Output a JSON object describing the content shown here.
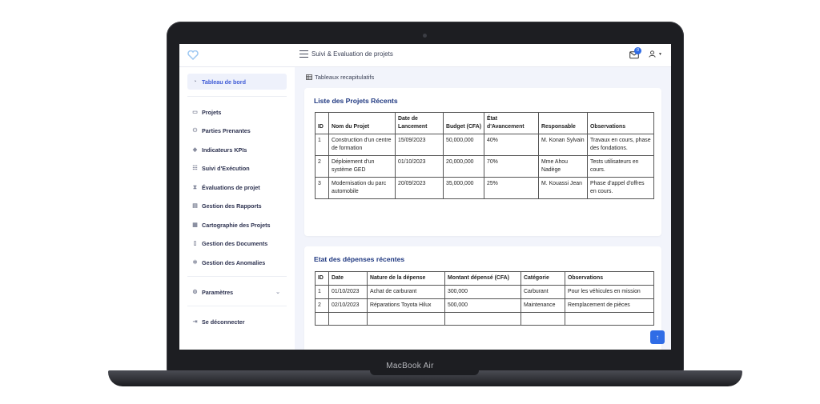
{
  "device": {
    "label": "MacBook Air"
  },
  "topbar": {
    "title": "Suivi & Evaluation de projets",
    "mail_badge": "0"
  },
  "sidebar": {
    "items": [
      {
        "label": "Tableau de bord",
        "icon": "dashboard-icon"
      },
      {
        "label": "Projets",
        "icon": "folder-icon"
      },
      {
        "label": "Parties Prenantes",
        "icon": "users-icon"
      },
      {
        "label": "Indicateurs KPIs",
        "icon": "tag-icon"
      },
      {
        "label": "Suivi d'Exécution",
        "icon": "tasks-icon"
      },
      {
        "label": "Évaluations de projet",
        "icon": "hourglass-icon"
      },
      {
        "label": "Gestion des Rapports",
        "icon": "report-icon"
      },
      {
        "label": "Cartographie des Projets",
        "icon": "map-icon"
      },
      {
        "label": "Gestion des Documents",
        "icon": "document-icon"
      },
      {
        "label": "Gestion des Anomalies",
        "icon": "bug-icon"
      },
      {
        "label": "Paramètres",
        "icon": "settings-icon"
      },
      {
        "label": "Se déconnecter",
        "icon": "logout-icon"
      }
    ]
  },
  "breadcrumb": {
    "label": "Tableaux recapitulatifs"
  },
  "projects": {
    "title": "Liste des Projets Récents",
    "headers": [
      "ID",
      "Nom du Projet",
      "Date de Lancement",
      "Budget (CFA)",
      "État d'Avancement",
      "Responsable",
      "Observations"
    ],
    "rows": [
      [
        "1",
        "Construction d'un centre de formation",
        "15/09/2023",
        "50,000,000",
        "40%",
        "M. Konan Sylvain",
        "Travaux en cours, phase des fondations."
      ],
      [
        "2",
        "Déploiement d'un système GED",
        "01/10/2023",
        "20,000,000",
        "70%",
        "Mme Ahou Nadège",
        "Tests utilisateurs en cours."
      ],
      [
        "3",
        "Modernisation du parc automobile",
        "20/09/2023",
        "35,000,000",
        "25%",
        "M. Kouassi Jean",
        "Phase d'appel d'offres en cours."
      ]
    ]
  },
  "expenses": {
    "title": "Etat des dépenses récentes",
    "headers": [
      "ID",
      "Date",
      "Nature de la dépense",
      "Montant dépensé (CFA)",
      "Catégorie",
      "Observations"
    ],
    "rows": [
      [
        "1",
        "01/10/2023",
        "Achat de carburant",
        "300,000",
        "Carburant",
        "Pour les véhicules en mission"
      ],
      [
        "2",
        "02/10/2023",
        "Réparations Toyota Hilux",
        "500,000",
        "Maintenance",
        "Remplacement de pièces"
      ]
    ]
  },
  "colors": {
    "accent": "#2f6ce6",
    "title": "#1f3880",
    "background": "#f2f4fb"
  }
}
